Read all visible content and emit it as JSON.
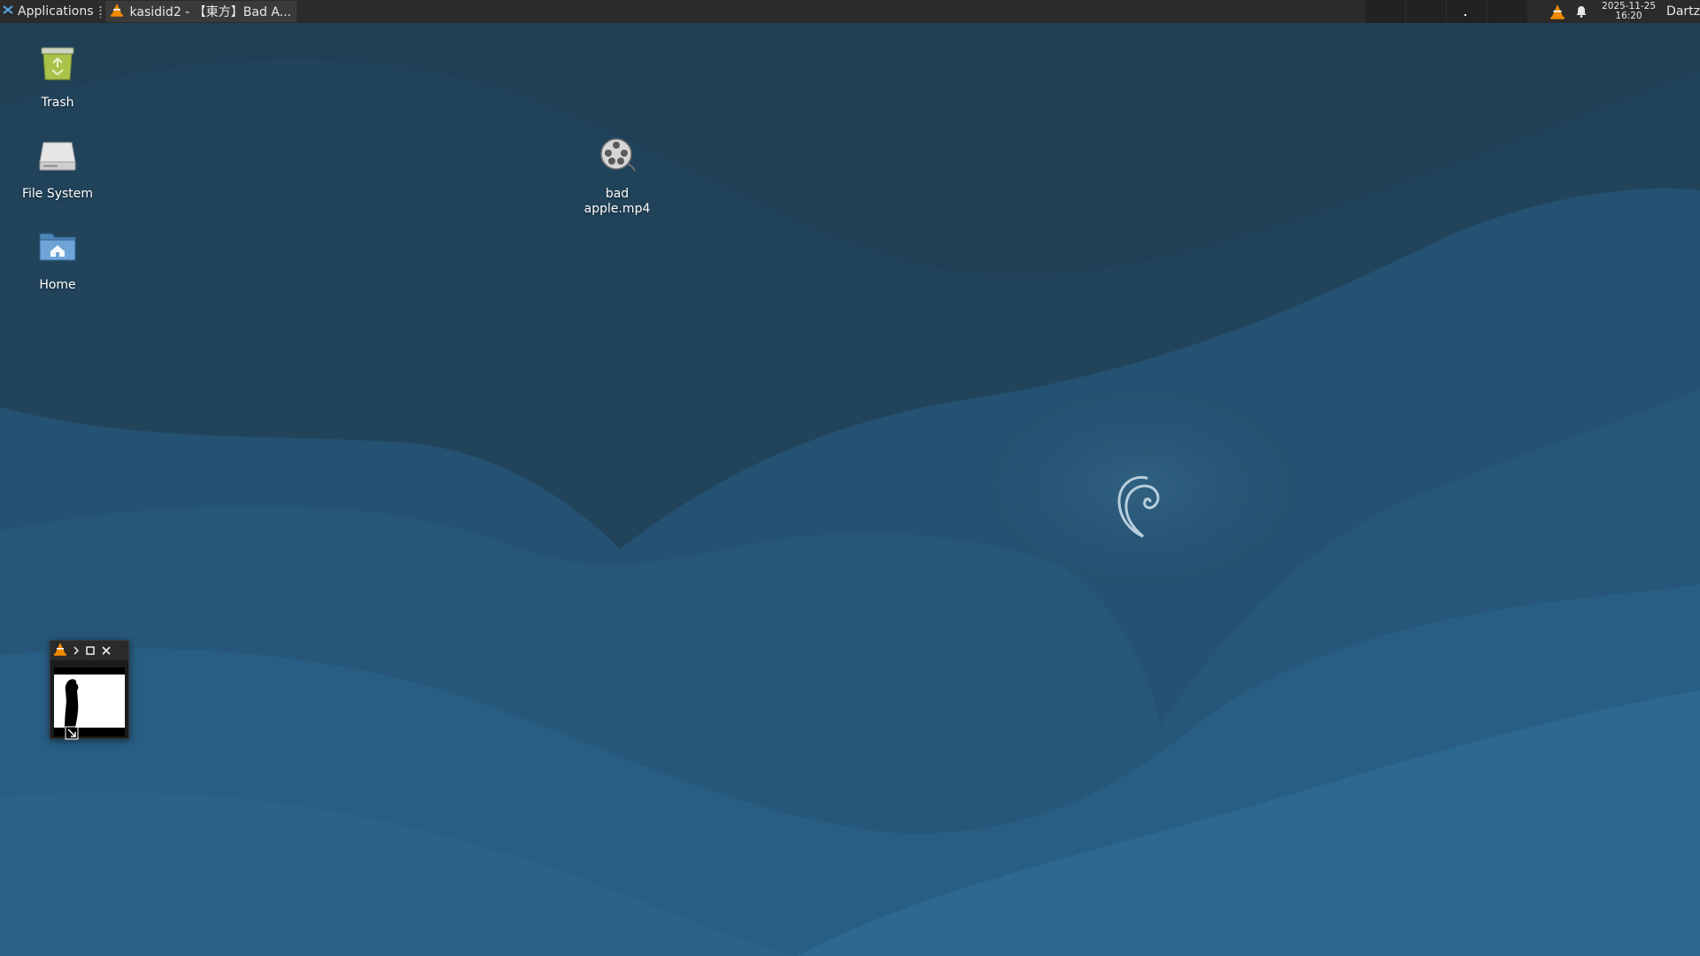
{
  "panel": {
    "applications_label": "Applications",
    "task_title": "kasidid2 - 【東方】Bad A...",
    "clock_date": "2025-11-25",
    "clock_time": "16:20",
    "user_label": "Dartz"
  },
  "desktop_icons": {
    "trash": "Trash",
    "filesystem": "File System",
    "home": "Home",
    "video_line1": "bad",
    "video_line2": "apple.mp4"
  },
  "colors": {
    "panel_bg": "#2b2b2b",
    "wallpaper_dark": "#1f3e53",
    "wallpaper_light": "#2f6e99",
    "vlc_orange": "#f08a00"
  },
  "icons": [
    "applications-icon",
    "vlc-icon",
    "notification-bell-icon",
    "trash-icon",
    "drive-icon",
    "home-folder-icon",
    "video-reel-icon",
    "debian-swirl-logo",
    "resize-cursor-icon"
  ]
}
